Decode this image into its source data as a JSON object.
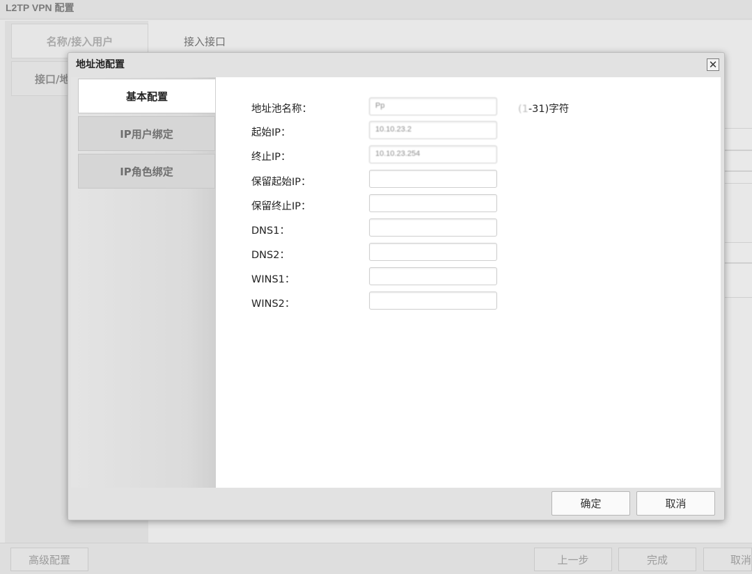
{
  "window": {
    "title": "L2TP VPN 配置",
    "tabs": [
      "名称/接入用户",
      "接口/地"
    ],
    "main_label": "接入接口"
  },
  "bottom": {
    "advanced": "高级配置",
    "prev": "上一步",
    "finish": "完成",
    "cancel": "取消"
  },
  "dialog": {
    "title": "地址池配置",
    "close_glyph": "✕",
    "tabs": [
      {
        "label": "基本配置",
        "active": true
      },
      {
        "label": "IP用户绑定",
        "active": false
      },
      {
        "label": "IP角色绑定",
        "active": false
      }
    ],
    "fields": [
      {
        "label": "地址池名称：",
        "value": "Pp"
      },
      {
        "label": "起始IP：",
        "value": "10.10.23.2"
      },
      {
        "label": "终止IP：",
        "value": "10.10.23.254"
      },
      {
        "label": "保留起始IP：",
        "value": ""
      },
      {
        "label": "保留终止IP：",
        "value": ""
      },
      {
        "label": "DNS1：",
        "value": ""
      },
      {
        "label": "DNS2：",
        "value": ""
      },
      {
        "label": "WINS1：",
        "value": ""
      },
      {
        "label": "WINS2：",
        "value": ""
      }
    ],
    "hint_prefix": "(1",
    "hint": "-31)字符",
    "ok": "确定",
    "cancel": "取消"
  },
  "colors": {
    "dialog_bg": "#e2e2e2",
    "content_bg": "#ffffff",
    "page_bg": "#e6e6e6"
  }
}
